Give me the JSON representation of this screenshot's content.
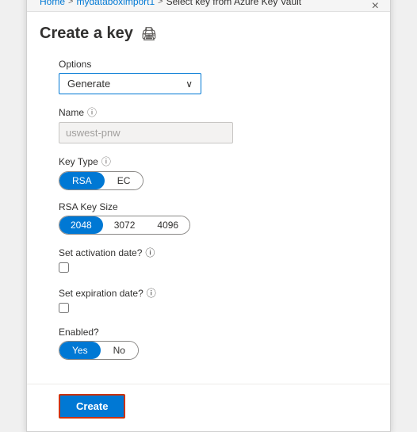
{
  "breadcrumb": {
    "items": [
      "Home",
      "mydataboximport1",
      "Select key from Azure Key Vault"
    ],
    "separators": [
      ">",
      ">",
      ">"
    ]
  },
  "header": {
    "title": "Create a key",
    "print_icon": "🖨",
    "close_icon": "×"
  },
  "form": {
    "options_label": "Options",
    "options_value": "Generate",
    "options_chevron": "∨",
    "name_label": "Name",
    "name_placeholder": "uswest-pnw",
    "name_info": "ⓘ",
    "key_type_label": "Key Type",
    "key_type_info": "ⓘ",
    "key_type_options": [
      "RSA",
      "EC"
    ],
    "key_type_active": "RSA",
    "rsa_size_label": "RSA Key Size",
    "rsa_sizes": [
      "2048",
      "3072",
      "4096"
    ],
    "rsa_active": "2048",
    "activation_label": "Set activation date?",
    "activation_info": "ⓘ",
    "expiration_label": "Set expiration date?",
    "expiration_info": "ⓘ",
    "enabled_label": "Enabled?",
    "enabled_options": [
      "Yes",
      "No"
    ],
    "enabled_active": "Yes"
  },
  "footer": {
    "create_label": "Create"
  }
}
